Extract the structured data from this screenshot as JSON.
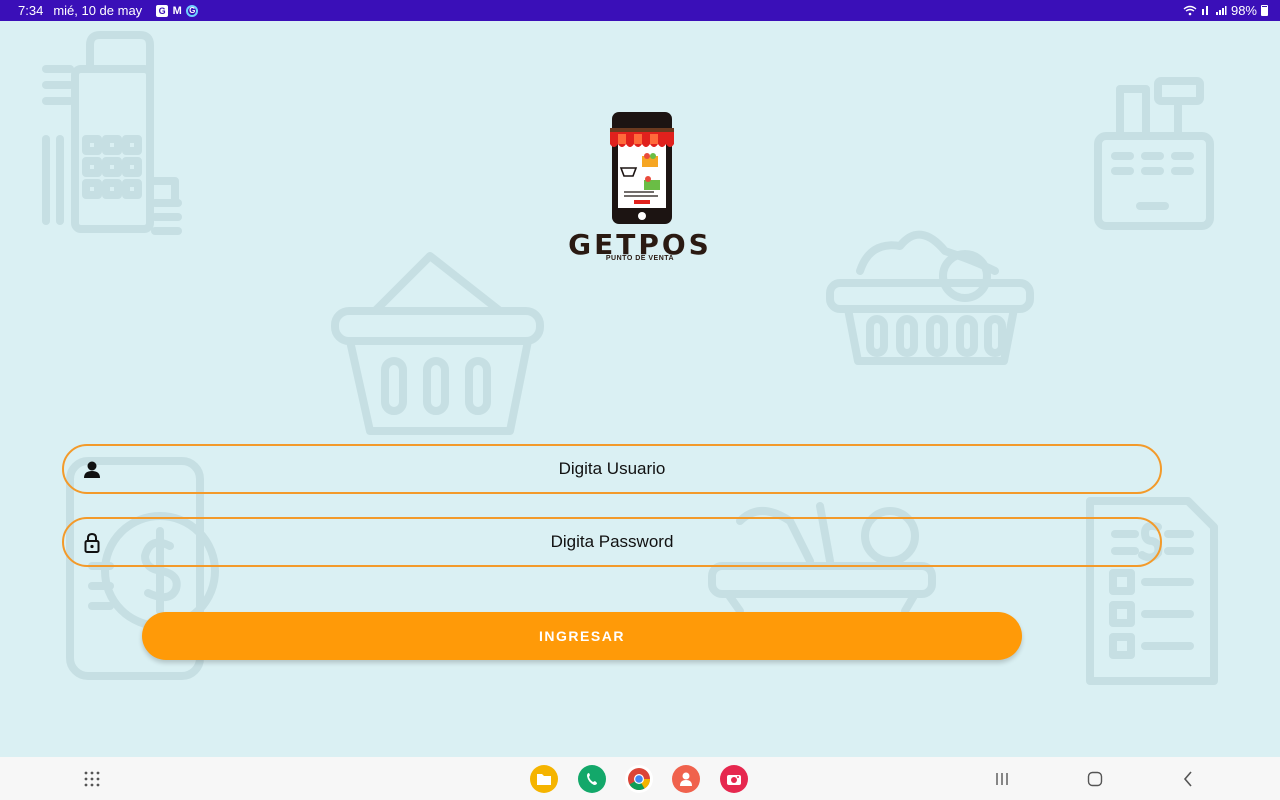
{
  "status_bar": {
    "time": "7:34",
    "date": "mié, 10 de may",
    "notification_icons": [
      "calendar-g-icon",
      "gmail-icon",
      "google-icon"
    ],
    "battery_text": "98%"
  },
  "logo": {
    "title": "GETPOS",
    "subtitle": "PUNTO DE VENTA"
  },
  "login": {
    "username_placeholder": "Digita Usuario",
    "password_placeholder": "Digita Password",
    "submit_label": "INGRESAR"
  },
  "colors": {
    "background": "#daf0f3",
    "status_bar": "#3a0fb8",
    "accent": "#ff9a08",
    "field_border": "#f39a2a"
  },
  "nav_bar": {
    "app_drawer_icon": "grid-icon",
    "dock_apps": [
      "folder-icon",
      "phone-icon",
      "chrome-icon",
      "contacts-icon",
      "camera-icon"
    ],
    "system_buttons": [
      "recents-icon",
      "home-icon",
      "back-icon"
    ]
  }
}
